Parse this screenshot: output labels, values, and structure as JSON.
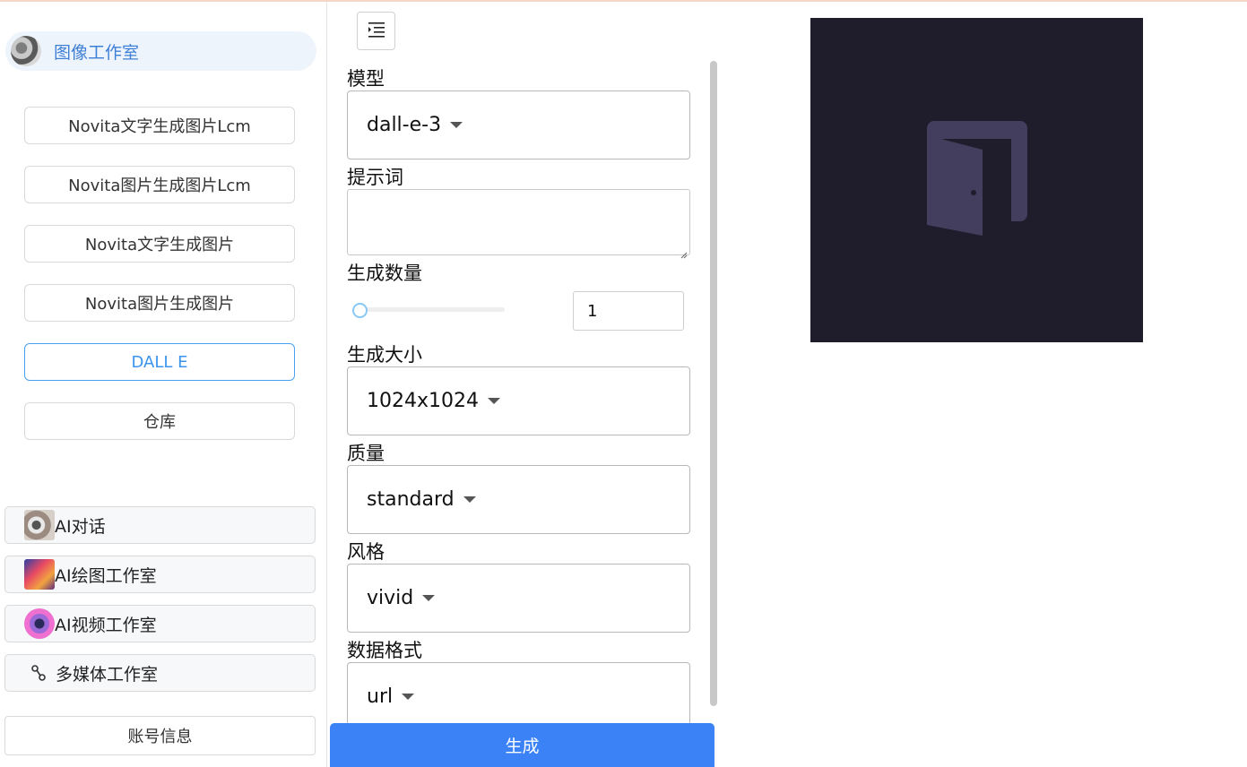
{
  "sidebar": {
    "brand_title": "图像工作室",
    "nav_buttons": [
      {
        "label": "Novita文字生成图片Lcm",
        "active": false
      },
      {
        "label": "Novita图片生成图片Lcm",
        "active": false
      },
      {
        "label": "Novita文字生成图片",
        "active": false
      },
      {
        "label": "Novita图片生成图片",
        "active": false
      },
      {
        "label": "DALL E",
        "active": true
      },
      {
        "label": "仓库",
        "active": false
      }
    ],
    "apps": [
      {
        "label": "AI对话",
        "icon": "ai-chat-thumbnail"
      },
      {
        "label": "AI绘图工作室",
        "icon": "ai-paint-thumbnail"
      },
      {
        "label": "AI视频工作室",
        "icon": "ai-video-thumbnail"
      },
      {
        "label": "多媒体工作室",
        "icon": "multimedia-icon"
      }
    ],
    "account_label": "账号信息"
  },
  "form": {
    "model_label": "模型",
    "model_value": "dall-e-3",
    "prompt_label": "提示词",
    "prompt_value": "",
    "count_label": "生成数量",
    "count_value": "1",
    "size_label": "生成大小",
    "size_value": "1024x1024",
    "quality_label": "质量",
    "quality_value": "standard",
    "style_label": "风格",
    "style_value": "vivid",
    "format_label": "数据格式",
    "format_value": "url",
    "generate_label": "生成"
  },
  "colors": {
    "accent": "#3b82f6",
    "active_nav": "#3b95ee",
    "preview_bg": "#1f1d2b",
    "preview_icon": "#443e5e"
  }
}
